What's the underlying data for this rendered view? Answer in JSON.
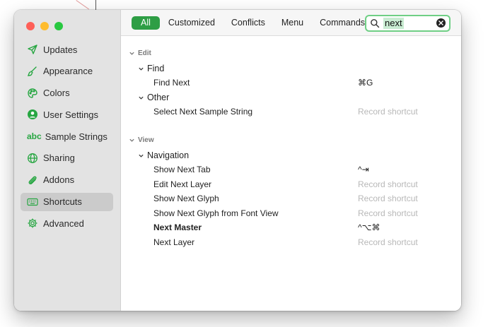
{
  "window": {
    "traffic_lights": [
      "close",
      "minimize",
      "zoom"
    ]
  },
  "sidebar": {
    "items": [
      {
        "label": "Updates",
        "icon": "paper-plane-icon",
        "active": false
      },
      {
        "label": "Appearance",
        "icon": "paintbrush-icon",
        "active": false
      },
      {
        "label": "Colors",
        "icon": "palette-icon",
        "active": false
      },
      {
        "label": "User Settings",
        "icon": "person-circle-icon",
        "active": false
      },
      {
        "label": "Sample Strings",
        "icon": "abc-icon",
        "icon_text": "abc",
        "active": false
      },
      {
        "label": "Sharing",
        "icon": "globe-icon",
        "active": false
      },
      {
        "label": "Addons",
        "icon": "paperclip-icon",
        "active": false
      },
      {
        "label": "Shortcuts",
        "icon": "keyboard-icon",
        "active": true
      },
      {
        "label": "Advanced",
        "icon": "gear-icon",
        "active": false
      }
    ]
  },
  "toolbar": {
    "filters": [
      "All",
      "Customized",
      "Conflicts",
      "Menu",
      "Commands"
    ],
    "active_filter": "All",
    "search": {
      "value": "next"
    }
  },
  "sections": [
    {
      "title": "Edit",
      "groups": [
        {
          "title": "Find",
          "items": [
            {
              "name": "Find Next",
              "shortcut": "⌘G",
              "placeholder": false,
              "bold": false
            }
          ]
        },
        {
          "title": "Other",
          "items": [
            {
              "name": "Select Next Sample String",
              "shortcut": "Record shortcut",
              "placeholder": true,
              "bold": false
            }
          ]
        }
      ]
    },
    {
      "title": "View",
      "groups": [
        {
          "title": "Navigation",
          "items": [
            {
              "name": "Show Next Tab",
              "shortcut": "^⇥",
              "placeholder": false,
              "bold": false
            },
            {
              "name": "Edit Next Layer",
              "shortcut": "Record shortcut",
              "placeholder": true,
              "bold": false
            },
            {
              "name": "Show Next Glyph",
              "shortcut": "Record shortcut",
              "placeholder": true,
              "bold": false
            },
            {
              "name": "Show Next Glyph from Font View",
              "shortcut": "Record shortcut",
              "placeholder": true,
              "bold": false
            },
            {
              "name": "Next Master",
              "shortcut": "^⌥⌘",
              "placeholder": false,
              "bold": true
            },
            {
              "name": "Next Layer",
              "shortcut": "Record shortcut",
              "placeholder": true,
              "bold": false
            }
          ]
        }
      ]
    }
  ],
  "colors": {
    "accent": "#2e9e45",
    "icon_green": "#26a641",
    "placeholder": "#b8b8b8"
  }
}
